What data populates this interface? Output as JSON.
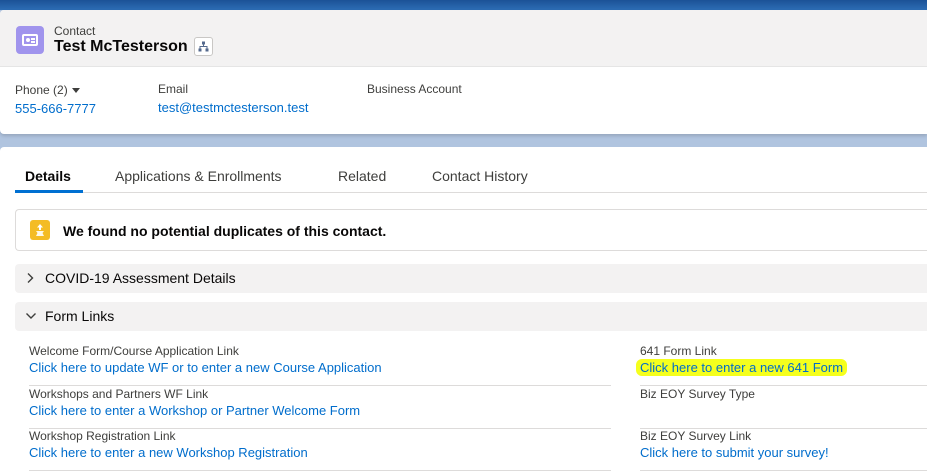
{
  "header": {
    "object_type": "Contact",
    "record_name": "Test McTesterson",
    "icons": {
      "object": "contact-card-icon",
      "hierarchy": "hierarchy-icon"
    },
    "fields": {
      "phone_label": "Phone (2)",
      "phone_value": "555-666-7777",
      "email_label": "Email",
      "email_value": "test@testmctesterson.test",
      "account_label": "Business Account",
      "account_value": ""
    }
  },
  "tabs": [
    "Details",
    "Applications & Enrollments",
    "Related",
    "Contact History"
  ],
  "active_tab": "Details",
  "duplicates": {
    "message": "We found no potential duplicates of this contact.",
    "icon": "duplicate-icon"
  },
  "sections": {
    "covid": {
      "title": "COVID-19 Assessment Details",
      "expanded": false
    },
    "form_links": {
      "title": "Form Links",
      "expanded": true
    }
  },
  "form_links": {
    "left": [
      {
        "label": "Welcome Form/Course Application Link",
        "link": "Click here to update WF or to enter a new Course Application"
      },
      {
        "label": "Workshops and Partners WF Link",
        "link": "Click here to enter a Workshop or Partner Welcome Form"
      },
      {
        "label": "Workshop Registration Link",
        "link": "Click here to enter a new Workshop Registration"
      }
    ],
    "right": [
      {
        "label": "641 Form Link",
        "link": "Click here to enter a new 641 Form"
      },
      {
        "label": "Biz EOY Survey Type",
        "link": ""
      },
      {
        "label": "Biz EOY Survey Link",
        "link": "Click here to submit your survey!"
      }
    ]
  },
  "colors": {
    "link": "#006dcc",
    "highlight": "#f5ff1d",
    "brand_band": "#1b5297",
    "contact_icon": "#a094ed",
    "warning_icon": "#f4bc25",
    "active_tab_underline": "#0070d2"
  }
}
